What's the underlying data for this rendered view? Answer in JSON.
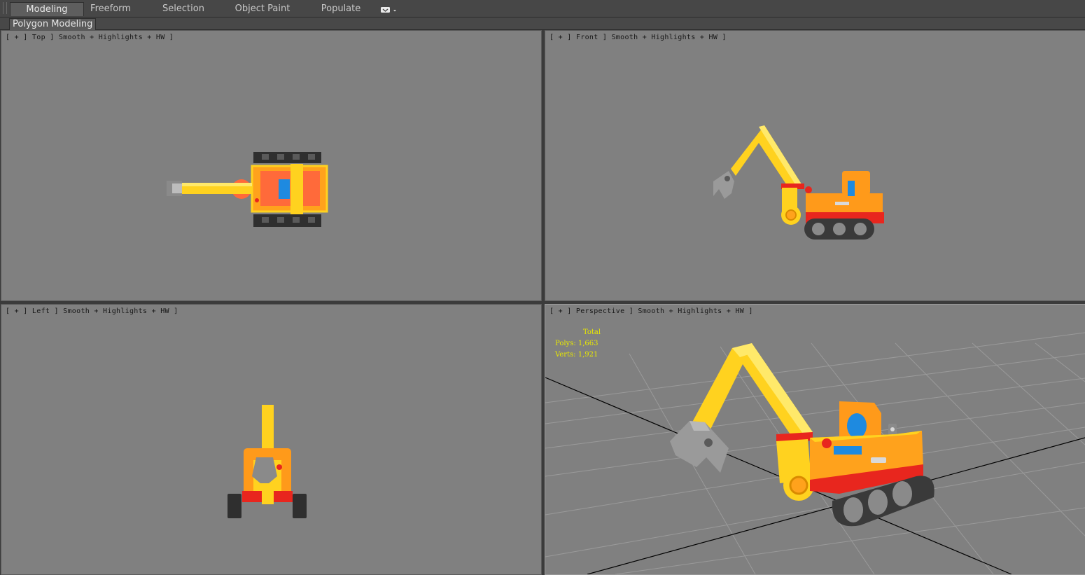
{
  "ribbon": {
    "tabs": [
      {
        "label": "Modeling",
        "active": true
      },
      {
        "label": "Freeform",
        "active": false
      },
      {
        "label": "Selection",
        "active": false
      },
      {
        "label": "Object Paint",
        "active": false
      },
      {
        "label": "Populate",
        "active": false
      }
    ],
    "sub_label": "Polygon Modeling"
  },
  "viewports": {
    "top": {
      "label": "[ + ] Top ] Smooth + Highlights + HW ]"
    },
    "front": {
      "label": "[ + ] Front ] Smooth + Highlights + HW ]"
    },
    "left": {
      "label": "[ + ] Left ] Smooth + Highlights + HW ]"
    },
    "perspective": {
      "label": "[ + ] Perspective ] Smooth + Highlights + HW ]",
      "stats": {
        "title": "Total",
        "polys_label": "Polys:",
        "polys_value": "1,663",
        "verts_label": "Verts:",
        "verts_value": "1,921"
      }
    }
  },
  "colors": {
    "viewport_bg": "#808080",
    "stats_text": "#e8e800",
    "body_yellow": "#ffd21f",
    "body_orange": "#ff9a1a",
    "track_red": "#e8261e",
    "seat_blue": "#1e8ae0",
    "claw_gray": "#9a9a9a"
  },
  "icons": {
    "ribbon_menu": "display-dropdown-icon"
  }
}
